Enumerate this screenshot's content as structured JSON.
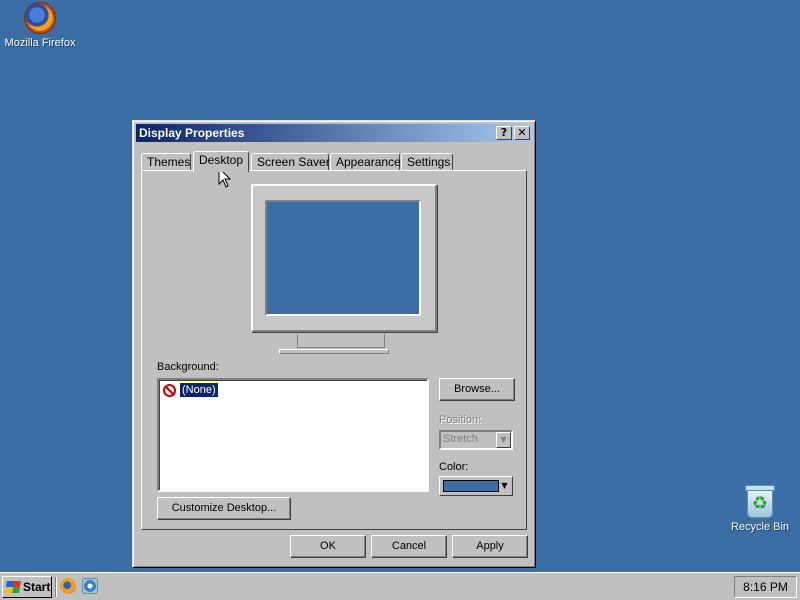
{
  "desktop": {
    "icons": [
      {
        "label": "Mozilla Firefox",
        "icon": "firefox-icon"
      },
      {
        "label": "Recycle Bin",
        "icon": "recycle-bin-icon"
      }
    ],
    "background_color": "#3a6ea5"
  },
  "dialog": {
    "title": "Display Properties",
    "title_buttons": {
      "help": "?",
      "close": "✕"
    },
    "tabs": [
      {
        "label": "Themes",
        "active": false
      },
      {
        "label": "Desktop",
        "active": true
      },
      {
        "label": "Screen Saver",
        "active": false
      },
      {
        "label": "Appearance",
        "active": false
      },
      {
        "label": "Settings",
        "active": false
      }
    ],
    "background_label": "Background:",
    "background_items": [
      {
        "label": "(None)",
        "icon": "no-symbol-icon",
        "selected": true
      }
    ],
    "browse_label": "Browse...",
    "position_label": "Position:",
    "position_value": "Stretch",
    "color_label": "Color:",
    "color_value": "#3a6ea5",
    "customize_label": "Customize Desktop...",
    "ok_label": "OK",
    "cancel_label": "Cancel",
    "apply_label": "Apply"
  },
  "taskbar": {
    "start_label": "Start",
    "quick_launch": [
      "firefox-icon",
      "internet-explorer-icon"
    ],
    "clock": "8:16 PM"
  }
}
